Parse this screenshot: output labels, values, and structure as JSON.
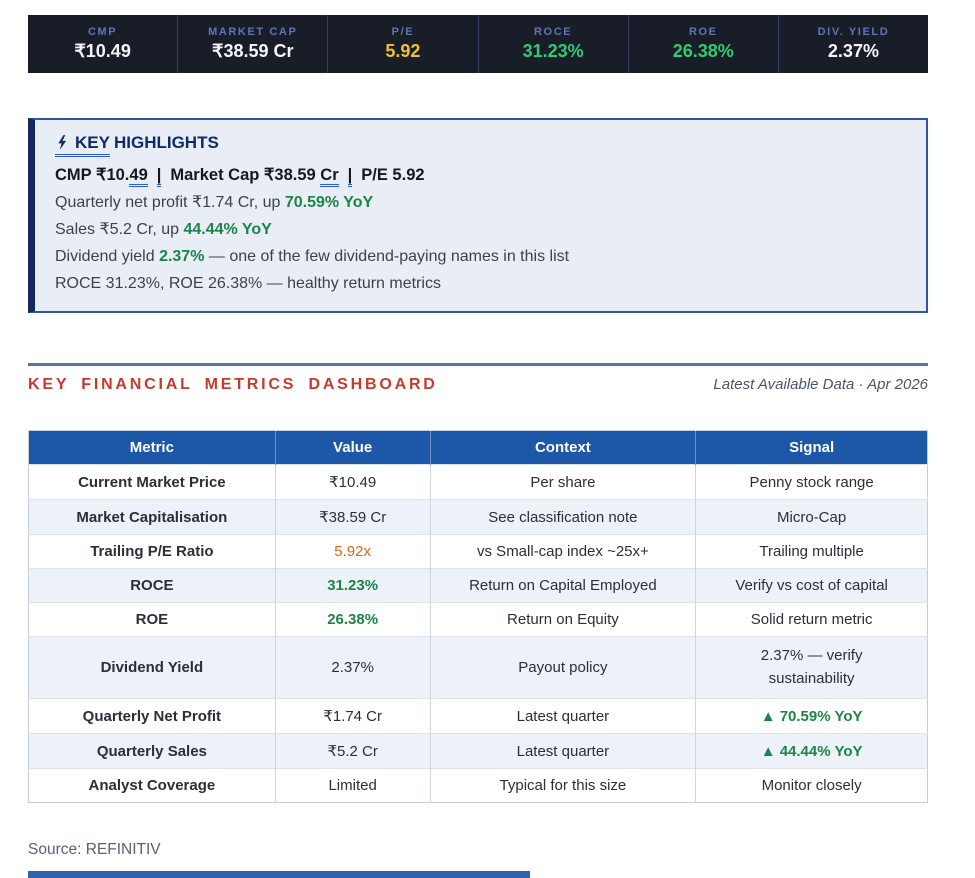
{
  "top_bar": {
    "metrics": [
      {
        "label": "CMP",
        "value": "₹10.49",
        "value_class": "tv tv-white"
      },
      {
        "label": "MARKET CAP",
        "value": "₹38.59 Cr",
        "value_class": "tv tv-white"
      },
      {
        "label": "P/E",
        "value": "5.92",
        "value_class": "tv tv-yellow"
      },
      {
        "label": "ROCE",
        "value": "31.23%",
        "value_class": "tv tv-green"
      },
      {
        "label": "ROE",
        "value": "26.38%",
        "value_class": "tv tv-green"
      },
      {
        "label": "DIV. YIELD",
        "value": "2.37%",
        "value_class": "tv tv-white"
      }
    ]
  },
  "highlights": {
    "icon": "lightning-bolt",
    "title_underlined": "KEY",
    "title_rest": "HIGHLIGHTS",
    "line1": {
      "t1": "CMP ₹10.",
      "u1": "49",
      "s1": "|",
      "t2": "Market Cap ₹38.59 ",
      "u2": "Cr",
      "s2": "|",
      "t3": "P/E 5.92"
    },
    "lines": [
      {
        "pre": "Quarterly net profit ₹1.74 Cr, up ",
        "strong": "70.59% YoY",
        "post": ""
      },
      {
        "pre": "Sales ₹5.2 Cr, up ",
        "strong": "44.44% YoY",
        "post": ""
      },
      {
        "pre": "Dividend yield ",
        "strong": "2.37%",
        "post": " — one of the few dividend-paying names in this list"
      },
      {
        "pre": "ROCE 31.23%, ROE 26.38% — healthy return metrics",
        "strong": "",
        "post": ""
      }
    ]
  },
  "dashboard": {
    "title": "KEY FINANCIAL METRICS DASHBOARD",
    "meta": "Latest Available Data · Apr 2026"
  },
  "table": {
    "headers": [
      "Metric",
      "Value",
      "Context",
      "Signal"
    ],
    "rows": [
      {
        "metric": "Current Market Price",
        "value": "₹10.49",
        "value_class": "cv",
        "context": "Per share",
        "signal": "Penny stock range",
        "signal_class": "cs"
      },
      {
        "metric": "Market Capitalisation",
        "value": "₹38.59 Cr",
        "value_class": "cv",
        "context": "See classification note",
        "signal": "Micro-Cap",
        "signal_class": "cs"
      },
      {
        "metric": "Trailing P/E Ratio",
        "value": "5.92x",
        "value_class": "cv v-orange",
        "context": "vs Small-cap index ~25x+",
        "signal": "Trailing multiple",
        "signal_class": "cs"
      },
      {
        "metric": "ROCE",
        "value": "31.23%",
        "value_class": "cv v-green",
        "context": "Return on Capital Employed",
        "signal": "Verify vs cost of capital",
        "signal_class": "cs"
      },
      {
        "metric": "ROE",
        "value": "26.38%",
        "value_class": "cv v-green",
        "context": "Return on Equity",
        "signal": "Solid return metric",
        "signal_class": "cs"
      },
      {
        "metric": "Dividend Yield",
        "value": "2.37%",
        "value_class": "cv",
        "context": "Payout policy",
        "signal": "2.37% — verify sustainability",
        "signal_class": "cs wrap"
      },
      {
        "metric": "Quarterly Net Profit",
        "value": "₹1.74 Cr",
        "value_class": "cv",
        "context": "Latest quarter",
        "signal": "▲ 70.59% YoY",
        "signal_class": "cs s-green"
      },
      {
        "metric": "Quarterly Sales",
        "value": "₹5.2 Cr",
        "value_class": "cv",
        "context": "Latest quarter",
        "signal": "▲ 44.44% YoY",
        "signal_class": "cs s-green"
      },
      {
        "metric": "Analyst Coverage",
        "value": "Limited",
        "value_class": "cv",
        "context": "Typical for this size",
        "signal": "Monitor closely",
        "signal_class": "cs"
      }
    ]
  },
  "footer": {
    "source": "Source: REFINITIV"
  },
  "colors": {
    "top_bar_bg": "#191d27",
    "header_blue": "#1d57a7",
    "title_red": "#c43b2e",
    "positive_green": "#1d8348",
    "bright_green": "#2ecc71",
    "pe_yellow": "#f0c12f",
    "orange": "#d2691e",
    "highlight_bg": "#e9edf6",
    "navy": "#0c2b68"
  }
}
